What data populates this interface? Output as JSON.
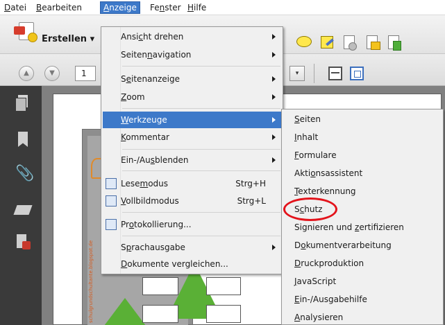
{
  "menubar": {
    "items": [
      {
        "pre": "",
        "acc": "D",
        "post": "atei"
      },
      {
        "pre": "",
        "acc": "B",
        "post": "earbeiten"
      },
      {
        "pre": "",
        "acc": "A",
        "post": "nzeige"
      },
      {
        "pre": "Fe",
        "acc": "n",
        "post": "ster"
      },
      {
        "pre": "",
        "acc": "H",
        "post": "ilfe"
      }
    ]
  },
  "toolbar": {
    "create_label": "Erstellen ▾",
    "page_number": "1",
    "zoom_arrow": "▾",
    "nav_up": "▲",
    "nav_down": "▼"
  },
  "view_menu": {
    "items": [
      {
        "pre": "Ansi",
        "acc": "c",
        "post": "ht drehen",
        "submenu": true
      },
      {
        "pre": "Seiten",
        "acc": "n",
        "post": "avigation",
        "submenu": true
      },
      {
        "pre": "S",
        "acc": "e",
        "post": "itenanzeige",
        "submenu": true
      },
      {
        "pre": "",
        "acc": "Z",
        "post": "oom",
        "submenu": true
      },
      {
        "pre": "",
        "acc": "W",
        "post": "erkzeuge",
        "submenu": true,
        "highlighted": true
      },
      {
        "pre": "",
        "acc": "K",
        "post": "ommentar",
        "submenu": true
      },
      {
        "pre": "Ein-/Au",
        "acc": "s",
        "post": "blenden",
        "submenu": true
      },
      {
        "pre": "Lese",
        "acc": "m",
        "post": "odus",
        "shortcut": "Strg+H",
        "icon": "read-mode-icon"
      },
      {
        "pre": "",
        "acc": "V",
        "post": "ollbildmodus",
        "shortcut": "Strg+L",
        "icon": "fullscreen-icon"
      },
      {
        "pre": "Pr",
        "acc": "o",
        "post": "tokollierung...",
        "icon": "log-icon"
      },
      {
        "pre": "S",
        "acc": "p",
        "post": "rachausgabe",
        "submenu": true
      },
      {
        "pre": "",
        "acc": "D",
        "post": "okumente vergleichen..."
      }
    ]
  },
  "tools_submenu": {
    "items": [
      {
        "pre": "",
        "acc": "S",
        "post": "eiten"
      },
      {
        "pre": "",
        "acc": "I",
        "post": "nhalt"
      },
      {
        "pre": "",
        "acc": "F",
        "post": "ormulare"
      },
      {
        "pre": "Akti",
        "acc": "o",
        "post": "nsassistent"
      },
      {
        "pre": "",
        "acc": "T",
        "post": "exterkennung"
      },
      {
        "pre": "S",
        "acc": "c",
        "post": "hutz"
      },
      {
        "pre": "Signieren und ",
        "acc": "z",
        "post": "ertifizieren"
      },
      {
        "pre": "D",
        "acc": "o",
        "post": "kumentverarbeitung"
      },
      {
        "pre": "",
        "acc": "D",
        "post": "ruckproduktion"
      },
      {
        "pre": "",
        "acc": "J",
        "post": "avaScript"
      },
      {
        "pre": "",
        "acc": "E",
        "post": "in-/Ausgabehilfe"
      },
      {
        "pre": "",
        "acc": "A",
        "post": "nalysieren"
      }
    ]
  },
  "document": {
    "watermark": "schulgrundschultante.blogspot.de"
  },
  "colors": {
    "menu_highlight": "#3d79c9",
    "annotation_circle": "#e3131b",
    "left_panel": "#3a3a3a"
  }
}
